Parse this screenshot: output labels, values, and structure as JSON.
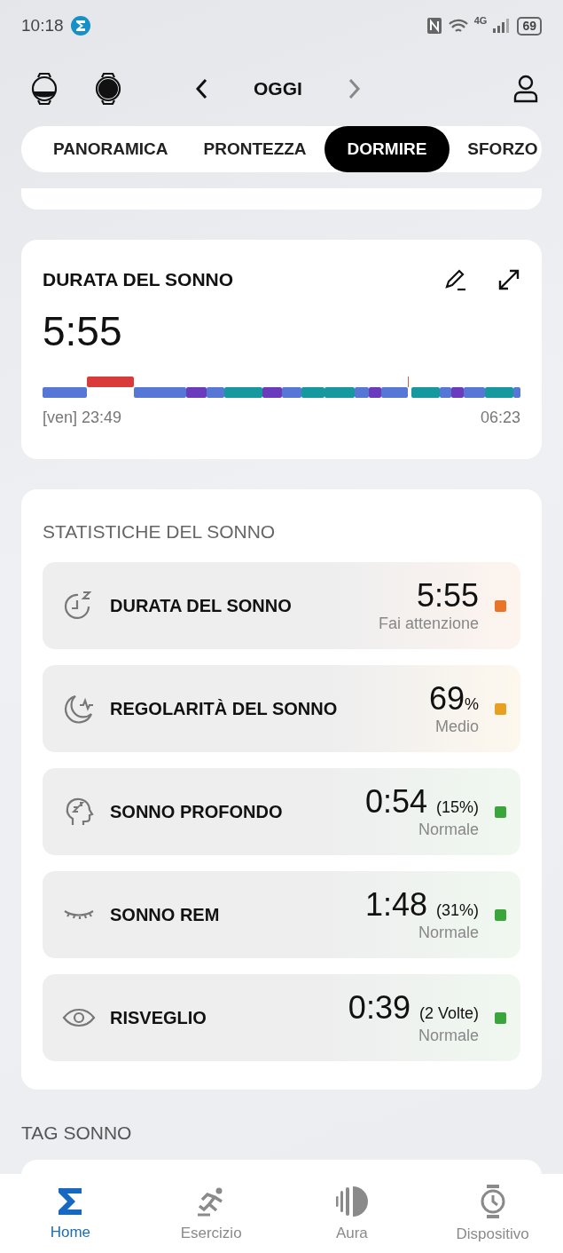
{
  "status_bar": {
    "time": "10:18",
    "network": "4G",
    "battery": "69"
  },
  "header": {
    "date": "OGGI"
  },
  "tabs": [
    {
      "label": "PANORAMICA",
      "selected": false
    },
    {
      "label": "PRONTEZZA",
      "selected": false
    },
    {
      "label": "DORMIRE",
      "selected": true
    },
    {
      "label": "SFORZO",
      "selected": false
    }
  ],
  "duration_card": {
    "title": "DURATA DEL SONNO",
    "value": "5:55",
    "start": "[ven] 23:49",
    "end": "06:23"
  },
  "stats": {
    "title": "STATISTICHE DEL SONNO",
    "rows": [
      {
        "kind": "duration",
        "label": "DURATA DEL SONNO",
        "value": "5:55",
        "status": "Fai attenzione",
        "color": "#e8742a"
      },
      {
        "kind": "regularity",
        "label": "REGOLARITÀ DEL SONNO",
        "value": "69",
        "unit": "%",
        "status": "Medio",
        "color": "#e8a020"
      },
      {
        "kind": "deep",
        "label": "SONNO PROFONDO",
        "value": "0:54",
        "detail": "(15%)",
        "status": "Normale",
        "color": "#3aa53a"
      },
      {
        "kind": "rem",
        "label": "SONNO REM",
        "value": "1:48",
        "detail": "(31%)",
        "status": "Normale",
        "color": "#3aa53a"
      },
      {
        "kind": "awake",
        "label": "RISVEGLIO",
        "value": "0:39",
        "detail": "(2 Volte)",
        "status": "Normale",
        "color": "#3aa53a"
      }
    ]
  },
  "tags_title": "TAG SONNO",
  "bottom_nav": [
    {
      "kind": "home",
      "label": "Home",
      "selected": true
    },
    {
      "kind": "exercise",
      "label": "Esercizio",
      "selected": false
    },
    {
      "kind": "aura",
      "label": "Aura",
      "selected": false
    },
    {
      "kind": "device",
      "label": "Dispositivo",
      "selected": false
    }
  ]
}
